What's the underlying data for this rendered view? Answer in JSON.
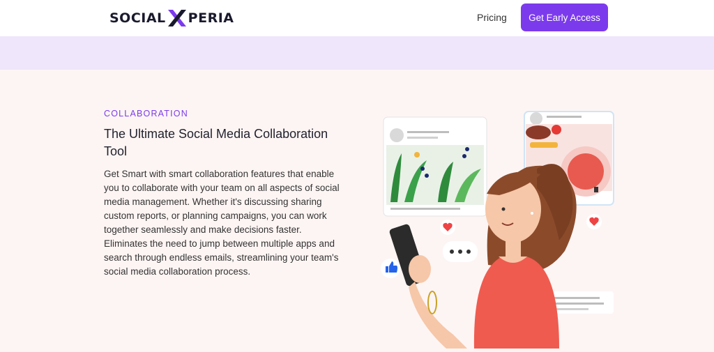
{
  "header": {
    "logo": {
      "left": "SOCIAL",
      "right": "PERIA"
    },
    "nav": {
      "pricing": "Pricing"
    },
    "cta": "Get Early Access"
  },
  "section": {
    "eyebrow": "COLLABORATION",
    "title": "The Ultimate Social Media Collaboration Tool",
    "body": "Get Smart with smart collaboration features that enable you to collaborate with your team on all aspects of social media management. Whether it's discussing sharing custom reports, or planning campaigns, you can work together seamlessly and make decisions faster. Eliminates the need to jump between multiple apps and search through endless emails, streamlining your team's social media collaboration process."
  },
  "colors": {
    "accent": "#7c3aed",
    "band": "#efe6fb",
    "background": "#fdf5f4",
    "heart": "#ef4444",
    "like": "#2563eb"
  },
  "icons": [
    "logo-x-icon",
    "avatar-icon",
    "heart-icon",
    "thumbs-up-icon",
    "typing-dots-icon",
    "bookmark-icon"
  ]
}
